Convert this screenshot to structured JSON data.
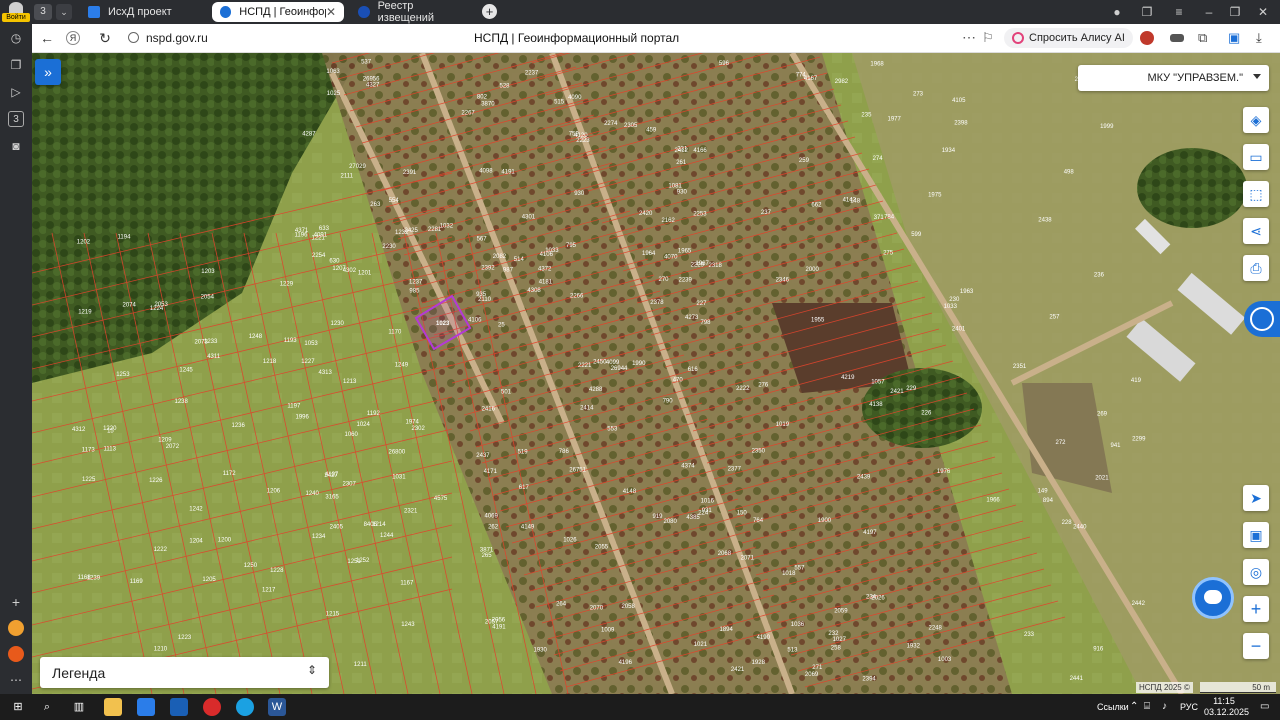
{
  "browser": {
    "profile_label": "Войти",
    "tabs": [
      {
        "title": "ИсхД проект",
        "active": false
      },
      {
        "title": "НСПД | Геоинформаци",
        "active": true
      },
      {
        "title": "Реестр извещений",
        "active": false
      }
    ],
    "url": "nspd.gov.ru",
    "page_title": "НСПД | Геоинформационный портал",
    "alice_label": "Спросить Алису AI",
    "sidebar_badge": "3"
  },
  "map": {
    "org_selector": "МКУ \"УПРАВЗЕМ.\"",
    "legend_label": "Легенда",
    "attribution": "НСПД 2025 ©",
    "scale_label": "50 m",
    "highlighted_parcel": "1023",
    "parcel_labels": [
      {
        "t": "25"
      },
      {
        "t": "2111"
      },
      {
        "t": "2110"
      },
      {
        "t": "4107"
      },
      {
        "t": "4106"
      },
      {
        "t": "2302"
      },
      {
        "t": "4090"
      },
      {
        "t": "4191"
      },
      {
        "t": "4120"
      },
      {
        "t": "4308"
      },
      {
        "t": "4327"
      },
      {
        "t": "4385"
      },
      {
        "t": "4302"
      },
      {
        "t": "4166"
      },
      {
        "t": "4106"
      },
      {
        "t": "930"
      },
      {
        "t": "8406"
      },
      {
        "t": "4098"
      },
      {
        "t": "4301"
      },
      {
        "t": "1024"
      },
      {
        "t": "1032"
      },
      {
        "t": "3165"
      },
      {
        "t": "1031"
      },
      {
        "t": "1023"
      },
      {
        "t": "1033"
      },
      {
        "t": "26944"
      },
      {
        "t": "27029"
      },
      {
        "t": "3870"
      },
      {
        "t": "2254"
      },
      {
        "t": "2221"
      },
      {
        "t": "2253"
      },
      {
        "t": "935"
      },
      {
        "t": "2437"
      },
      {
        "t": "2392"
      },
      {
        "t": "2391"
      },
      {
        "t": "2274"
      },
      {
        "t": "1974"
      },
      {
        "t": "919"
      },
      {
        "t": "4374"
      },
      {
        "t": "4099"
      },
      {
        "t": "2237"
      },
      {
        "t": "2281"
      },
      {
        "t": "2230"
      },
      {
        "t": "2414"
      },
      {
        "t": "2321"
      },
      {
        "t": "4371"
      },
      {
        "t": "4372"
      },
      {
        "t": "2405"
      },
      {
        "t": "4171"
      },
      {
        "t": "4181"
      },
      {
        "t": "1060"
      },
      {
        "t": "1081"
      },
      {
        "t": "4287"
      },
      {
        "t": "4288"
      },
      {
        "t": "26751"
      },
      {
        "t": "26800"
      },
      {
        "t": "26956"
      },
      {
        "t": "1063"
      },
      {
        "t": "519"
      },
      {
        "t": "459"
      },
      {
        "t": "528"
      },
      {
        "t": "985"
      },
      {
        "t": "633"
      },
      {
        "t": "554"
      },
      {
        "t": "2305"
      },
      {
        "t": "537"
      },
      {
        "t": "515"
      },
      {
        "t": "2267"
      },
      {
        "t": "2082"
      },
      {
        "t": "1996"
      },
      {
        "t": "2416"
      },
      {
        "t": "4575"
      },
      {
        "t": "2450"
      },
      {
        "t": "2425"
      },
      {
        "t": "2427"
      },
      {
        "t": "1025"
      },
      {
        "t": "263"
      },
      {
        "t": "1053"
      },
      {
        "t": "567"
      },
      {
        "t": "617"
      },
      {
        "t": "514"
      },
      {
        "t": "2307"
      },
      {
        "t": "2266"
      },
      {
        "t": "470"
      },
      {
        "t": "4069"
      },
      {
        "t": "4070"
      },
      {
        "t": "501"
      },
      {
        "t": "4148"
      },
      {
        "t": "4149"
      },
      {
        "t": "786"
      },
      {
        "t": "802"
      },
      {
        "t": "798"
      },
      {
        "t": "795"
      },
      {
        "t": "553"
      },
      {
        "t": "987"
      },
      {
        "t": "790"
      },
      {
        "t": "4091"
      },
      {
        "t": "262"
      },
      {
        "t": "759"
      },
      {
        "t": "2223"
      },
      {
        "t": "2222"
      },
      {
        "t": "774"
      },
      {
        "t": "419"
      },
      {
        "t": "2378"
      },
      {
        "t": "2377"
      },
      {
        "t": "764"
      },
      {
        "t": "1036"
      },
      {
        "t": "1033"
      },
      {
        "t": "498"
      },
      {
        "t": "1955"
      },
      {
        "t": "269"
      },
      {
        "t": "261"
      },
      {
        "t": "784"
      },
      {
        "t": "4219"
      },
      {
        "t": "4167"
      },
      {
        "t": "2080"
      },
      {
        "t": "4138"
      },
      {
        "t": "1999"
      },
      {
        "t": "4142"
      },
      {
        "t": "2982"
      },
      {
        "t": "224"
      },
      {
        "t": "223"
      },
      {
        "t": "599"
      },
      {
        "t": "662"
      },
      {
        "t": "2351"
      },
      {
        "t": "2350"
      },
      {
        "t": "916"
      },
      {
        "t": "258"
      },
      {
        "t": "257"
      },
      {
        "t": "930"
      },
      {
        "t": "931"
      },
      {
        "t": "1003"
      },
      {
        "t": "2346"
      },
      {
        "t": "259"
      },
      {
        "t": "941"
      },
      {
        "t": "894"
      },
      {
        "t": "1019"
      },
      {
        "t": "1016"
      },
      {
        "t": "2299"
      },
      {
        "t": "2000"
      },
      {
        "t": "226"
      },
      {
        "t": "227"
      },
      {
        "t": "228"
      },
      {
        "t": "229"
      },
      {
        "t": "230"
      },
      {
        "t": "231"
      },
      {
        "t": "232"
      },
      {
        "t": "233"
      },
      {
        "t": "234"
      },
      {
        "t": "235"
      },
      {
        "t": "236"
      },
      {
        "t": "237"
      },
      {
        "t": "270"
      },
      {
        "t": "271"
      },
      {
        "t": "272"
      },
      {
        "t": "273"
      },
      {
        "t": "274"
      },
      {
        "t": "275"
      },
      {
        "t": "276"
      },
      {
        "t": "1975"
      },
      {
        "t": "1976"
      },
      {
        "t": "1977"
      },
      {
        "t": "1990"
      },
      {
        "t": "1968"
      },
      {
        "t": "2398"
      },
      {
        "t": "1965"
      },
      {
        "t": "2439"
      },
      {
        "t": "2442"
      },
      {
        "t": "596"
      },
      {
        "t": "2441"
      },
      {
        "t": "2440"
      },
      {
        "t": "2248"
      },
      {
        "t": "1964"
      },
      {
        "t": "4105"
      },
      {
        "t": "1963"
      },
      {
        "t": "513"
      },
      {
        "t": "1934"
      },
      {
        "t": "1966"
      },
      {
        "t": "2420"
      },
      {
        "t": "1967"
      },
      {
        "t": "2162"
      },
      {
        "t": "2421"
      },
      {
        "t": "1932"
      },
      {
        "t": "2239"
      },
      {
        "t": "2412"
      },
      {
        "t": "2318"
      },
      {
        "t": "2229"
      },
      {
        "t": "4273"
      },
      {
        "t": "557"
      },
      {
        "t": "1057"
      },
      {
        "t": "2021"
      },
      {
        "t": "1900"
      },
      {
        "t": "371"
      },
      {
        "t": "2438"
      },
      {
        "t": "2401"
      },
      {
        "t": "2026"
      },
      {
        "t": "616"
      },
      {
        "t": "148"
      },
      {
        "t": "149"
      },
      {
        "t": "150"
      },
      {
        "t": "15"
      },
      {
        "t": "630"
      },
      {
        "t": "4311"
      },
      {
        "t": "4312"
      },
      {
        "t": "4313"
      },
      {
        "t": "1173"
      },
      {
        "t": "1172"
      },
      {
        "t": "1168"
      },
      {
        "t": "1200"
      },
      {
        "t": "1207"
      },
      {
        "t": "1167"
      },
      {
        "t": "1170"
      },
      {
        "t": "1238"
      },
      {
        "t": "1244"
      },
      {
        "t": "1192"
      },
      {
        "t": "1205"
      },
      {
        "t": "1169"
      },
      {
        "t": "1206"
      },
      {
        "t": "1242"
      },
      {
        "t": "1220"
      },
      {
        "t": "1203"
      },
      {
        "t": "1248"
      },
      {
        "t": "1216"
      },
      {
        "t": "1193"
      },
      {
        "t": "1210"
      },
      {
        "t": "1222"
      },
      {
        "t": "1197"
      },
      {
        "t": "1201"
      },
      {
        "t": "1194"
      },
      {
        "t": "1215"
      },
      {
        "t": "1196"
      },
      {
        "t": "1219"
      },
      {
        "t": "1235"
      },
      {
        "t": "1202"
      },
      {
        "t": "1226"
      },
      {
        "t": "1229"
      },
      {
        "t": "1209"
      },
      {
        "t": "1113"
      },
      {
        "t": "1225"
      },
      {
        "t": "1234"
      },
      {
        "t": "1249"
      },
      {
        "t": "1214"
      },
      {
        "t": "1221"
      },
      {
        "t": "1253"
      },
      {
        "t": "1250"
      },
      {
        "t": "1228"
      },
      {
        "t": "1243"
      },
      {
        "t": "1224"
      },
      {
        "t": "1227"
      },
      {
        "t": "1213"
      },
      {
        "t": "1233"
      },
      {
        "t": "1223"
      },
      {
        "t": "1232"
      },
      {
        "t": "1245"
      },
      {
        "t": "1211"
      },
      {
        "t": "1230"
      },
      {
        "t": "1204"
      },
      {
        "t": "1217"
      },
      {
        "t": "1218"
      },
      {
        "t": "1251"
      },
      {
        "t": "1252"
      },
      {
        "t": "1240"
      },
      {
        "t": "1239"
      },
      {
        "t": "1237"
      },
      {
        "t": "1236"
      },
      {
        "t": "2054"
      },
      {
        "t": "2073"
      },
      {
        "t": "2053"
      },
      {
        "t": "2074"
      },
      {
        "t": "2072"
      },
      {
        "t": "2055"
      },
      {
        "t": "2071"
      },
      {
        "t": "265"
      },
      {
        "t": "2056"
      },
      {
        "t": "2070"
      },
      {
        "t": "2057"
      },
      {
        "t": "2069"
      },
      {
        "t": "2058"
      },
      {
        "t": "2068"
      },
      {
        "t": "2059"
      },
      {
        "t": "264"
      },
      {
        "t": "3871"
      },
      {
        "t": "1894"
      },
      {
        "t": "1930"
      },
      {
        "t": "1928"
      },
      {
        "t": "1009"
      },
      {
        "t": "1021"
      },
      {
        "t": "1027"
      },
      {
        "t": "4196"
      },
      {
        "t": "4190"
      },
      {
        "t": "4197"
      },
      {
        "t": "4191"
      },
      {
        "t": "2394"
      },
      {
        "t": "1026"
      },
      {
        "t": "1018"
      },
      {
        "t": "2421"
      }
    ]
  },
  "taskbar": {
    "time": "11:15",
    "date": "03.12.2025",
    "lang": "РУС",
    "links_label": "Ссылки"
  },
  "colors": {
    "accent": "#1b6fd6",
    "parcel_border": "#e0442c",
    "highlight": "#b43ad6",
    "road": "#c9b08a"
  }
}
